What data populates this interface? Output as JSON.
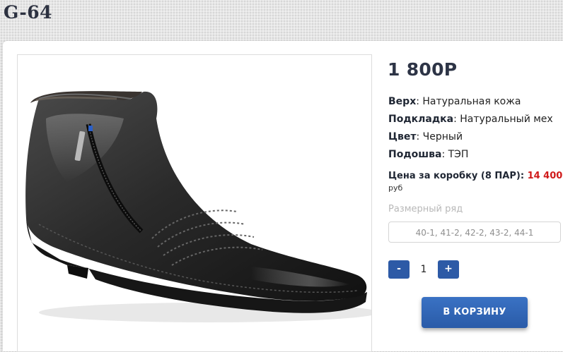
{
  "product": {
    "title": "G-64",
    "price": "1 800Р",
    "image_icon": "boot-photo"
  },
  "specs": [
    {
      "label": "Верх",
      "value": "Натуральная кожа"
    },
    {
      "label": "Подкладка",
      "value": "Натуральный мех"
    },
    {
      "label": "Цвет",
      "value": "Черный"
    },
    {
      "label": "Подошва",
      "value": "ТЭП"
    }
  ],
  "box_price": {
    "label": "Цена за коробку (8 ПАР):",
    "value": "14 400",
    "unit": "руб"
  },
  "sizes": {
    "label": "Размерный ряд",
    "value": "40-1, 41-2, 42-2, 43-2, 44-1"
  },
  "quantity": {
    "minus_label": "-",
    "value": "1",
    "plus_label": "+"
  },
  "cart": {
    "button_label": "В КОРЗИНУ"
  },
  "colors": {
    "accent": "#2d5aa6",
    "box_price_value": "#d01a1a",
    "title": "#2c3140"
  }
}
